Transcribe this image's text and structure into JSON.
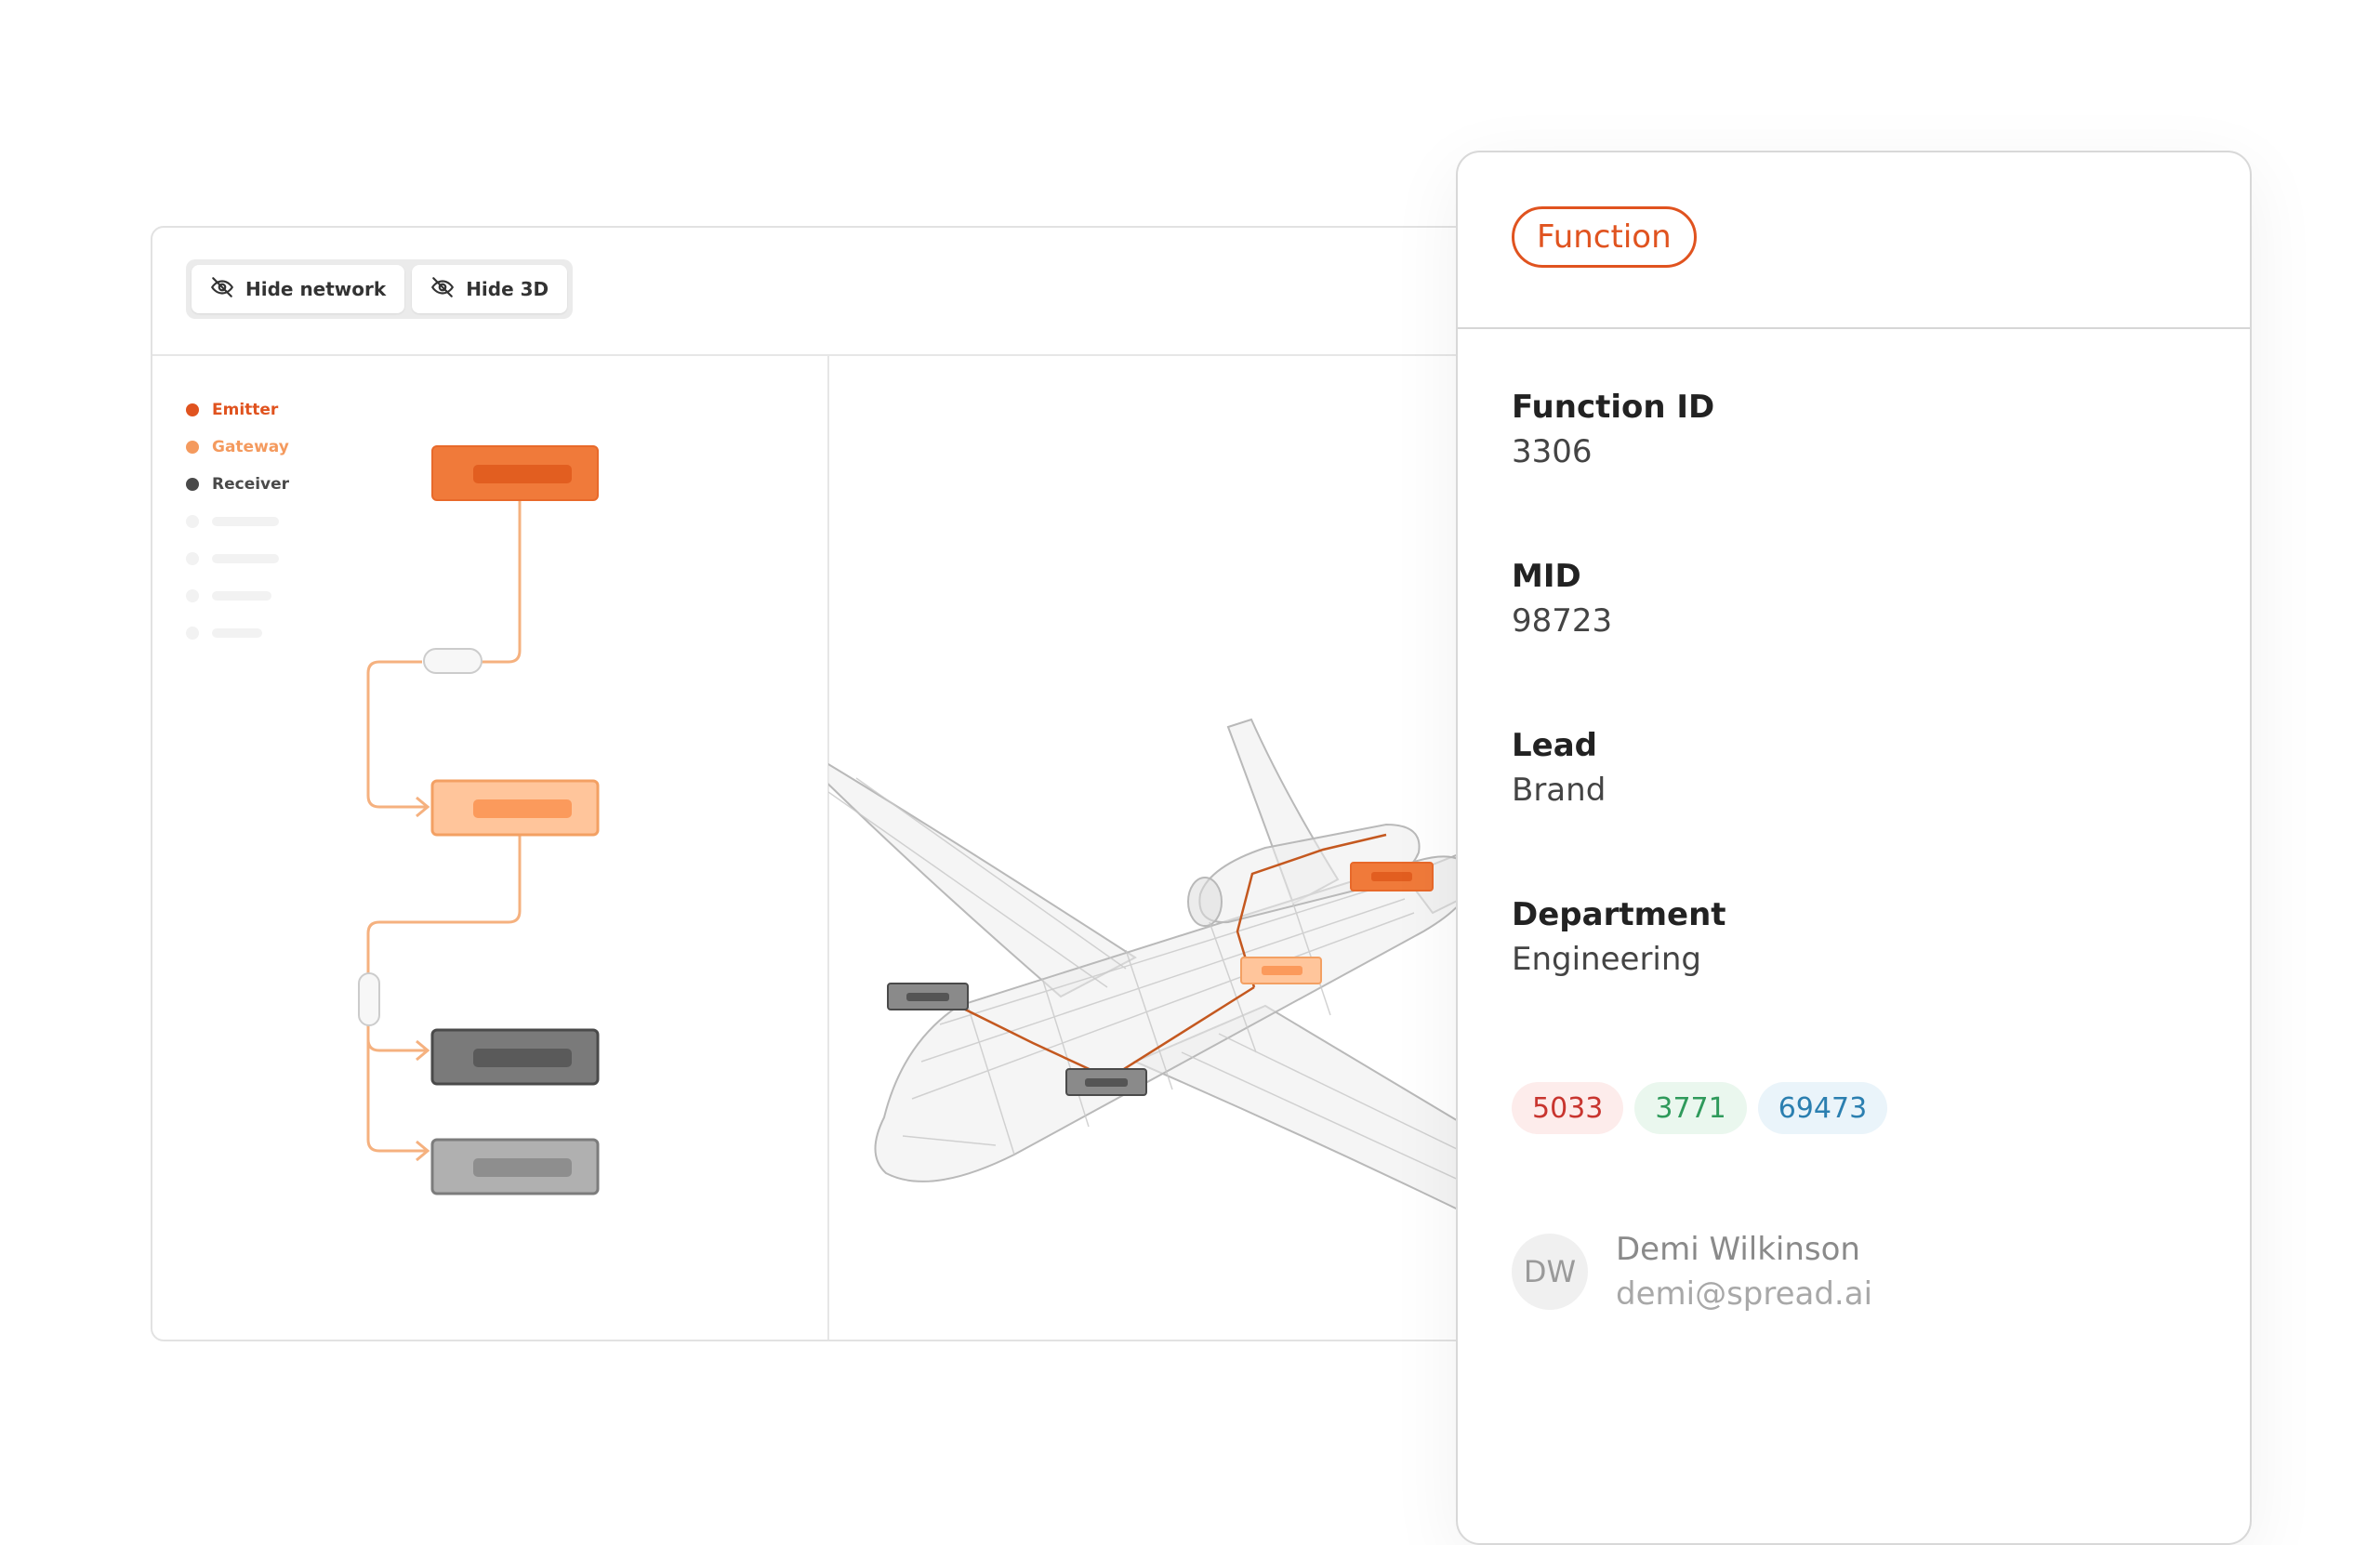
{
  "toolbar": {
    "hide_network_label": "Hide network",
    "hide_3d_label": "Hide 3D"
  },
  "legend": {
    "items": [
      {
        "label": "Emitter",
        "color": "#e0531f"
      },
      {
        "label": "Gateway",
        "color": "#f49a5e"
      },
      {
        "label": "Receiver",
        "color": "#4a4a4a"
      }
    ]
  },
  "diagram": {
    "node_colors": {
      "emitter": "#f07a3a",
      "gateway": "#ffc59b",
      "receiver_dark": "#6e6e6e",
      "receiver_light": "#a4a4a4",
      "connector": "#f5b17f"
    }
  },
  "panel": {
    "type_label": "Function",
    "fields": [
      {
        "label": "Function ID",
        "value": "3306"
      },
      {
        "label": "MID",
        "value": "98723"
      },
      {
        "label": "Lead",
        "value": "Brand"
      },
      {
        "label": "Department",
        "value": "Engineering"
      }
    ],
    "tags": [
      {
        "label": "5033",
        "color": "#c8352f",
        "bg": "#fdeceb"
      },
      {
        "label": "3771",
        "color": "#2f9a5b",
        "bg": "#eaf7ee"
      },
      {
        "label": "69473",
        "color": "#2b7fb0",
        "bg": "#eaf4fa"
      }
    ],
    "user": {
      "initials": "DW",
      "name": "Demi Wilkinson",
      "email": "demi@spread.ai"
    }
  },
  "colors": {
    "accent": "#e0531f"
  }
}
